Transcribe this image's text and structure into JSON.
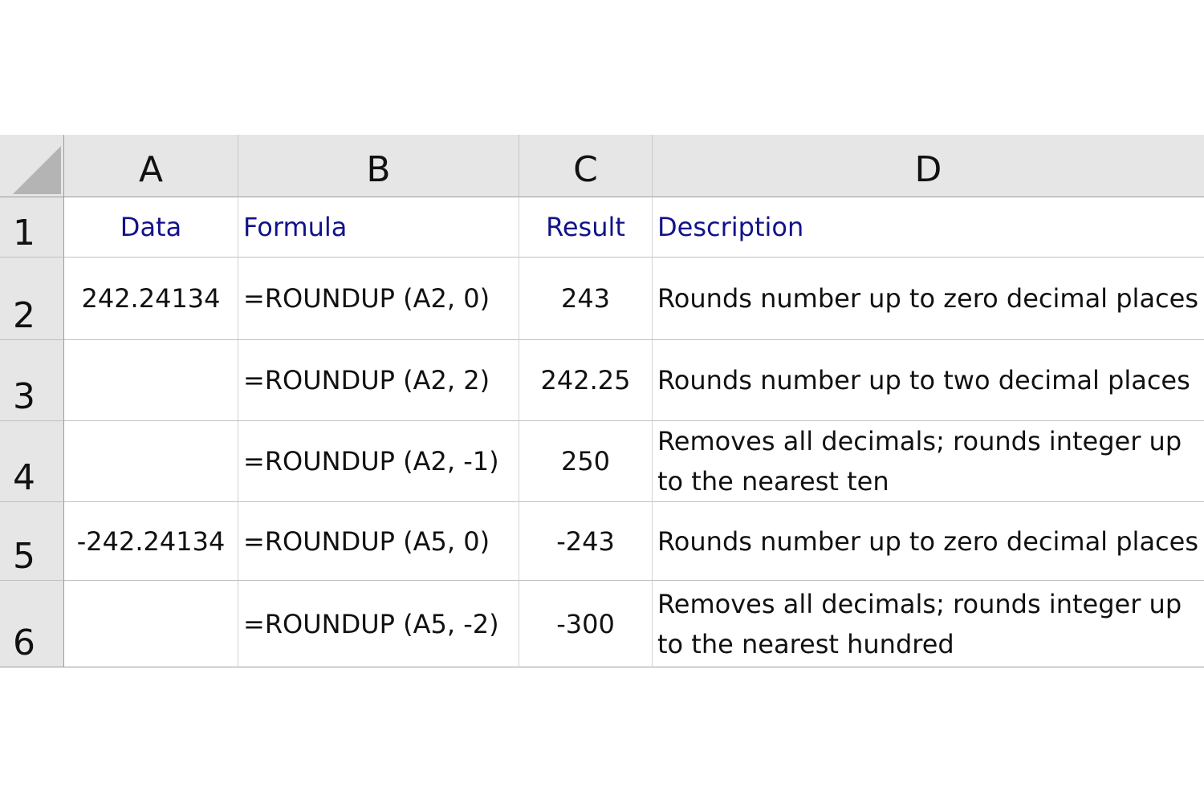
{
  "columns": [
    "A",
    "B",
    "C",
    "D"
  ],
  "rows": [
    {
      "num": "1",
      "cells": [
        "Data",
        "Formula",
        "Result",
        "Description"
      ]
    },
    {
      "num": "2",
      "cells": [
        "242.24134",
        "=ROUNDUP (A2, 0)",
        "243",
        "Rounds number up to zero decimal places"
      ]
    },
    {
      "num": "3",
      "cells": [
        "",
        "=ROUNDUP (A2, 2)",
        "242.25",
        "Rounds number up to two decimal places"
      ]
    },
    {
      "num": "4",
      "cells": [
        "",
        "=ROUNDUP (A2, -1)",
        "250",
        "Removes all decimals; rounds integer up to the nearest ten"
      ]
    },
    {
      "num": "5",
      "cells": [
        "-242.24134",
        "=ROUNDUP (A5, 0)",
        "-243",
        "Rounds number up to zero decimal places"
      ]
    },
    {
      "num": "6",
      "cells": [
        "",
        "=ROUNDUP (A5, -2)",
        "-300",
        "Removes all decimals; rounds integer up to the nearest hundred"
      ]
    }
  ]
}
